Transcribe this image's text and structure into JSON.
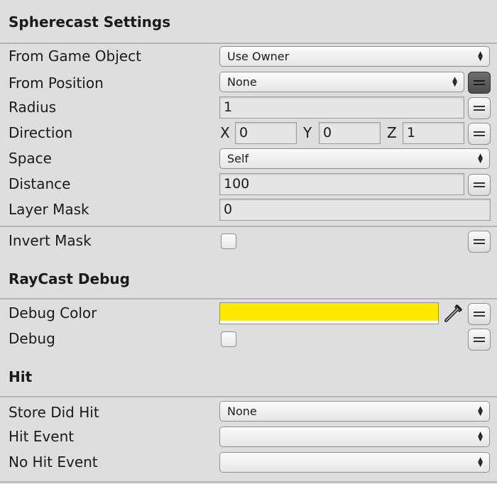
{
  "sections": {
    "spherecast_title": "Spherecast Settings",
    "raycast_debug_title": "RayCast Debug",
    "hit_title": "Hit"
  },
  "fields": {
    "from_game_object": {
      "label": "From Game Object",
      "value": "Use Owner"
    },
    "from_position": {
      "label": "From Position",
      "value": "None"
    },
    "radius": {
      "label": "Radius",
      "value": "1"
    },
    "direction": {
      "label": "Direction",
      "x_label": "X",
      "x": "0",
      "y_label": "Y",
      "y": "0",
      "z_label": "Z",
      "z": "1"
    },
    "space": {
      "label": "Space",
      "value": "Self"
    },
    "distance": {
      "label": "Distance",
      "value": "100"
    },
    "layer_mask": {
      "label": "Layer Mask",
      "value": "0"
    },
    "invert_mask": {
      "label": "Invert Mask",
      "checked": false
    },
    "debug_color": {
      "label": "Debug Color",
      "color": "#ffe900"
    },
    "debug": {
      "label": "Debug",
      "checked": false
    },
    "store_did_hit": {
      "label": "Store Did Hit",
      "value": "None"
    },
    "hit_event": {
      "label": "Hit Event",
      "value": ""
    },
    "no_hit_event": {
      "label": "No Hit Event",
      "value": ""
    }
  },
  "icons": {
    "dropdown_arrow": "updown-arrow-icon",
    "variable_toggle": "equals-icon",
    "color_picker": "eyedropper-icon"
  },
  "colors": {
    "background": "#dedede",
    "separator": "#b4b4b4",
    "field_bg": "#e6e6e6"
  }
}
